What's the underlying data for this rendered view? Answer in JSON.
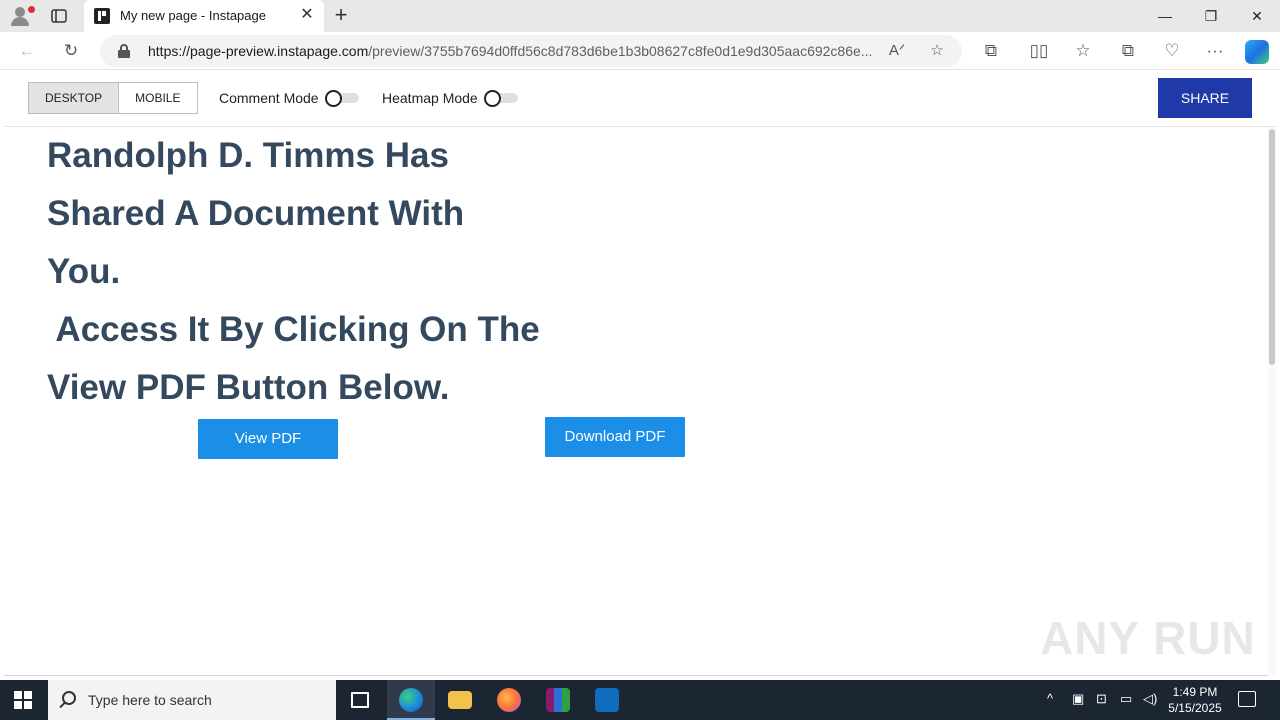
{
  "browser": {
    "tab_title": "My new page - Instapage",
    "tab_close": "✕",
    "new_tab": "+",
    "url_host": "https://page-preview.instapage.com",
    "url_path": "/preview/3755b7694d0ffd56c8d783d6be1b3b08627c8fe0d1e9d305aac692c86e...",
    "window_minimize": "—",
    "window_restore": "❐",
    "window_close": "✕"
  },
  "preview_toolbar": {
    "desktop_label": "DESKTOP",
    "mobile_label": "MOBILE",
    "comment_mode_label": "Comment Mode",
    "heatmap_mode_label": "Heatmap Mode",
    "share_label": "SHARE"
  },
  "page": {
    "heading_lines": [
      "Randolph D. Timms Has",
      "Shared A Document With",
      "You.",
      " Access It By Clicking On The",
      "View PDF Button Below."
    ],
    "view_pdf_label": "View PDF",
    "download_pdf_label": "Download PDF",
    "watermark": "ANY RUN"
  },
  "taskbar": {
    "search_placeholder": "Type here to search",
    "time": "1:49 PM",
    "date": "5/15/2025"
  },
  "colors": {
    "heading": "#34495e",
    "button_blue": "#1b8fe8",
    "share_blue": "#1f3aa8"
  }
}
